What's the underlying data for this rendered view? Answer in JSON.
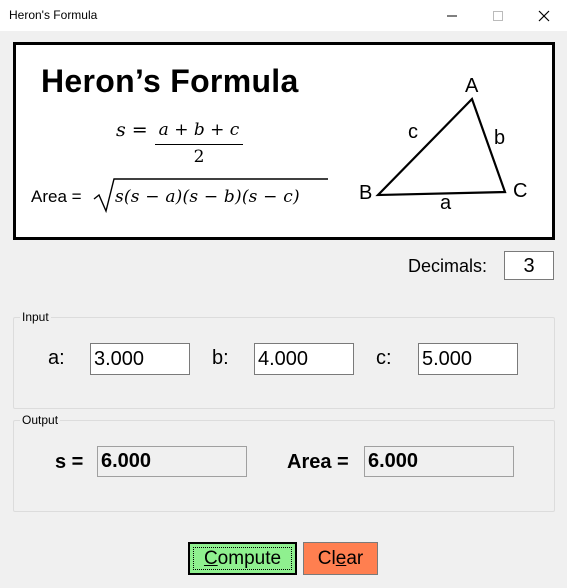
{
  "window": {
    "title": "Heron's Formula",
    "controls": {
      "minimize_icon": "minimize-icon",
      "maximize_icon": "maximize-icon",
      "close_icon": "close-icon"
    }
  },
  "banner": {
    "title": "Heron’s Formula",
    "s_lhs": "s =",
    "s_numerator": "a + b + c",
    "s_denominator": "2",
    "area_label": "Area =",
    "area_radicand": "s(s − a)(s − b)(s − c)",
    "triangle": {
      "vertex_a": "A",
      "vertex_b": "B",
      "vertex_c": "C",
      "side_a": "a",
      "side_b": "b",
      "side_c": "c"
    }
  },
  "decimals": {
    "label": "Decimals:",
    "value": "3"
  },
  "input": {
    "group_label": "Input",
    "a_label": "a:",
    "a_value": "3.000",
    "b_label": "b:",
    "b_value": "4.000",
    "c_label": "c:",
    "c_value": "5.000"
  },
  "output": {
    "group_label": "Output",
    "s_label": "s =",
    "s_value": "6.000",
    "area_label": "Area =",
    "area_value": "6.000"
  },
  "buttons": {
    "compute_pre": "",
    "compute_mnemonic": "C",
    "compute_post": "ompute",
    "clear_pre": "Cl",
    "clear_mnemonic": "e",
    "clear_post": "ar"
  },
  "colors": {
    "compute_bg": "#8ff08f",
    "clear_bg": "#ff7f50"
  }
}
